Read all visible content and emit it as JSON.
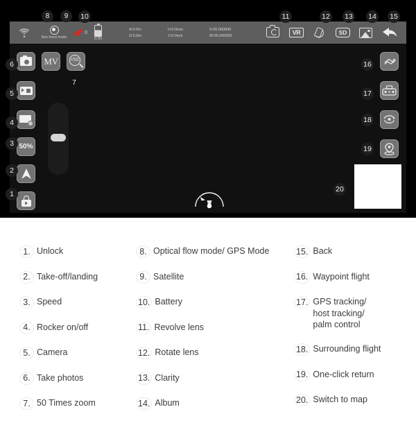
{
  "app": {
    "status_bar": {
      "wifi_icon": "wifi-icon",
      "gps_icon": "gps-mode-icon",
      "gps_mode_label": "Non-fixed mode",
      "satellite_icon": "satellite-icon",
      "satellite_count": "0",
      "battery_icon": "battery-icon",
      "battery_voltage": "0.0v",
      "telemetry": {
        "altitude": "A:0.0m",
        "distance": "D:0.0m",
        "horizontal_speed": "H:0.0m/s",
        "vertical_speed": "V:0.0m/s",
        "latitude": "S:00.000000",
        "longitude": "W:00.000000"
      },
      "right_icons": [
        {
          "name": "revolve-lens-icon",
          "label": ""
        },
        {
          "name": "vr-icon",
          "label": "VR"
        },
        {
          "name": "rotate-lens-icon",
          "label": ""
        },
        {
          "name": "sd-card-icon",
          "label": "SD"
        },
        {
          "name": "album-icon",
          "label": ""
        },
        {
          "name": "back-icon",
          "label": ""
        }
      ]
    },
    "left_controls": {
      "take_photos_icon": "camera-icon",
      "mv_label": "MV",
      "zoom_label": "×50",
      "camera_icon": "video-camera-icon",
      "rocker_icon": "rocker-toggle-icon",
      "speed_label": "50%",
      "takeoff_icon": "takeoff-landing-arrow-icon",
      "unlock_icon": "lock-icon"
    },
    "right_controls": {
      "waypoint_icon": "waypoint-flight-icon",
      "gps_tracking_icon": "remote-control-icon",
      "surrounding_icon": "surrounding-flight-icon",
      "return_icon": "one-click-return-icon",
      "map_thumbnail": "map-switch-thumbnail"
    },
    "callouts": {
      "n1": "1",
      "n2": "2",
      "n3": "3",
      "n4": "4",
      "n5": "5",
      "n6": "6",
      "n7": "7",
      "n8": "8",
      "n9": "9",
      "n10": "10",
      "n11": "11",
      "n12": "12",
      "n13": "13",
      "n14": "14",
      "n15": "15",
      "n16": "16",
      "n17": "17",
      "n18": "18",
      "n19": "19",
      "n20": "20"
    }
  },
  "legend": {
    "column1": [
      {
        "num": "1.",
        "text": "Unlock"
      },
      {
        "num": "2.",
        "text": "Take-off/landing"
      },
      {
        "num": "3.",
        "text": "Speed"
      },
      {
        "num": "4.",
        "text": "Rocker on/off"
      },
      {
        "num": "5.",
        "text": "Camera"
      },
      {
        "num": "6.",
        "text": "Take photos"
      },
      {
        "num": "7.",
        "text": "50 Times zoom"
      }
    ],
    "column2": [
      {
        "num": "8.",
        "text": "Optical flow mode/ GPS Mode"
      },
      {
        "num": "9.",
        "text": "Satellite"
      },
      {
        "num": "10.",
        "text": "Battery"
      },
      {
        "num": "11.",
        "text": "Revolve lens"
      },
      {
        "num": "12.",
        "text": "Rotate lens"
      },
      {
        "num": "13.",
        "text": "Clarity"
      },
      {
        "num": "14.",
        "text": "Album"
      }
    ],
    "column3": [
      {
        "num": "15.",
        "text": "Back"
      },
      {
        "num": "16.",
        "text": "Waypoint flight"
      },
      {
        "num": "17.",
        "text": "GPS tracking/\nhost tracking/\npalm control"
      },
      {
        "num": "18.",
        "text": "Surrounding flight"
      },
      {
        "num": "19.",
        "text": "One-click return"
      },
      {
        "num": "20.",
        "text": "Switch to map"
      }
    ]
  },
  "colors": {
    "panel_black": "#000000",
    "screen_dark": "#111111",
    "toolbar_gray": "#5e5e5e",
    "button_gray": "#737373",
    "accent_red": "#d52b1e",
    "text_light": "#e8e8e8",
    "legend_text": "#3c3c3c"
  }
}
